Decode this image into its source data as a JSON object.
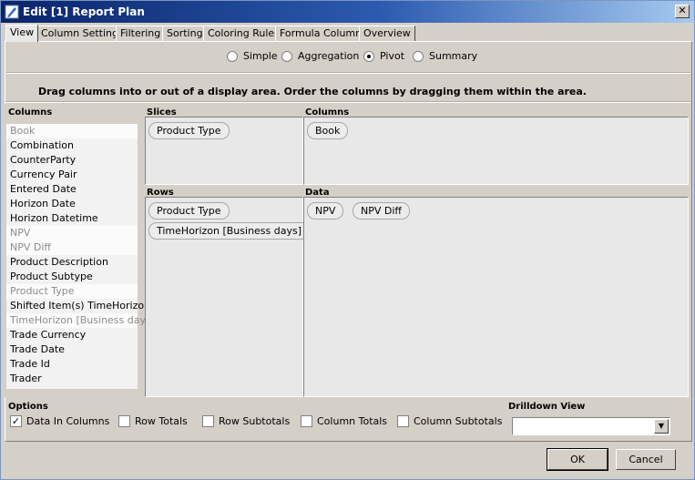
{
  "window": {
    "title": "Edit [1] Report Plan",
    "close_label": "✕"
  },
  "tabs": [
    {
      "label": "View",
      "active": true
    },
    {
      "label": "Column Settings"
    },
    {
      "label": "Filtering"
    },
    {
      "label": "Sorting"
    },
    {
      "label": "Coloring Rules"
    },
    {
      "label": "Formula Columns"
    },
    {
      "label": "Overview"
    }
  ],
  "modes": {
    "options": [
      "Simple",
      "Aggregation",
      "Pivot",
      "Summary"
    ],
    "selected": "Pivot"
  },
  "instruction": "Drag columns into or out of a display area. Order the columns by dragging them within the area.",
  "columns_panel": {
    "header": "Columns",
    "items": [
      {
        "label": "Book",
        "used": true
      },
      {
        "label": "Combination",
        "used": false
      },
      {
        "label": "CounterParty",
        "used": false
      },
      {
        "label": "Currency Pair",
        "used": false
      },
      {
        "label": "Entered Date",
        "used": false
      },
      {
        "label": "Horizon Date",
        "used": false
      },
      {
        "label": "Horizon Datetime",
        "used": false
      },
      {
        "label": "NPV",
        "used": true
      },
      {
        "label": "NPV Diff",
        "used": true
      },
      {
        "label": "Product Description",
        "used": false
      },
      {
        "label": "Product Subtype",
        "used": false
      },
      {
        "label": "Product Type",
        "used": true
      },
      {
        "label": "Shifted Item(s) TimeHorizon",
        "used": false
      },
      {
        "label": "TimeHorizon [Business days]",
        "used": true
      },
      {
        "label": "Trade Currency",
        "used": false
      },
      {
        "label": "Trade Date",
        "used": false
      },
      {
        "label": "Trade Id",
        "used": false
      },
      {
        "label": "Trader",
        "used": false
      }
    ]
  },
  "areas": {
    "slices": {
      "header": "Slices",
      "chips": [
        "Product Type"
      ]
    },
    "columns": {
      "header": "Columns",
      "chips": [
        "Book"
      ]
    },
    "rows": {
      "header": "Rows",
      "chips": [
        "Product Type",
        "TimeHorizon [Business days]"
      ]
    },
    "data": {
      "header": "Data",
      "chips": [
        "NPV",
        "NPV Diff"
      ]
    }
  },
  "options": {
    "header": "Options",
    "checkboxes": [
      {
        "label": "Data In Columns",
        "checked": true
      },
      {
        "label": "Row Totals",
        "checked": false
      },
      {
        "label": "Row Subtotals",
        "checked": false
      },
      {
        "label": "Column Totals",
        "checked": false
      },
      {
        "label": "Column Subtotals",
        "checked": false
      }
    ]
  },
  "drilldown": {
    "header": "Drilldown View",
    "value": ""
  },
  "buttons": {
    "ok": "OK",
    "cancel": "Cancel"
  }
}
